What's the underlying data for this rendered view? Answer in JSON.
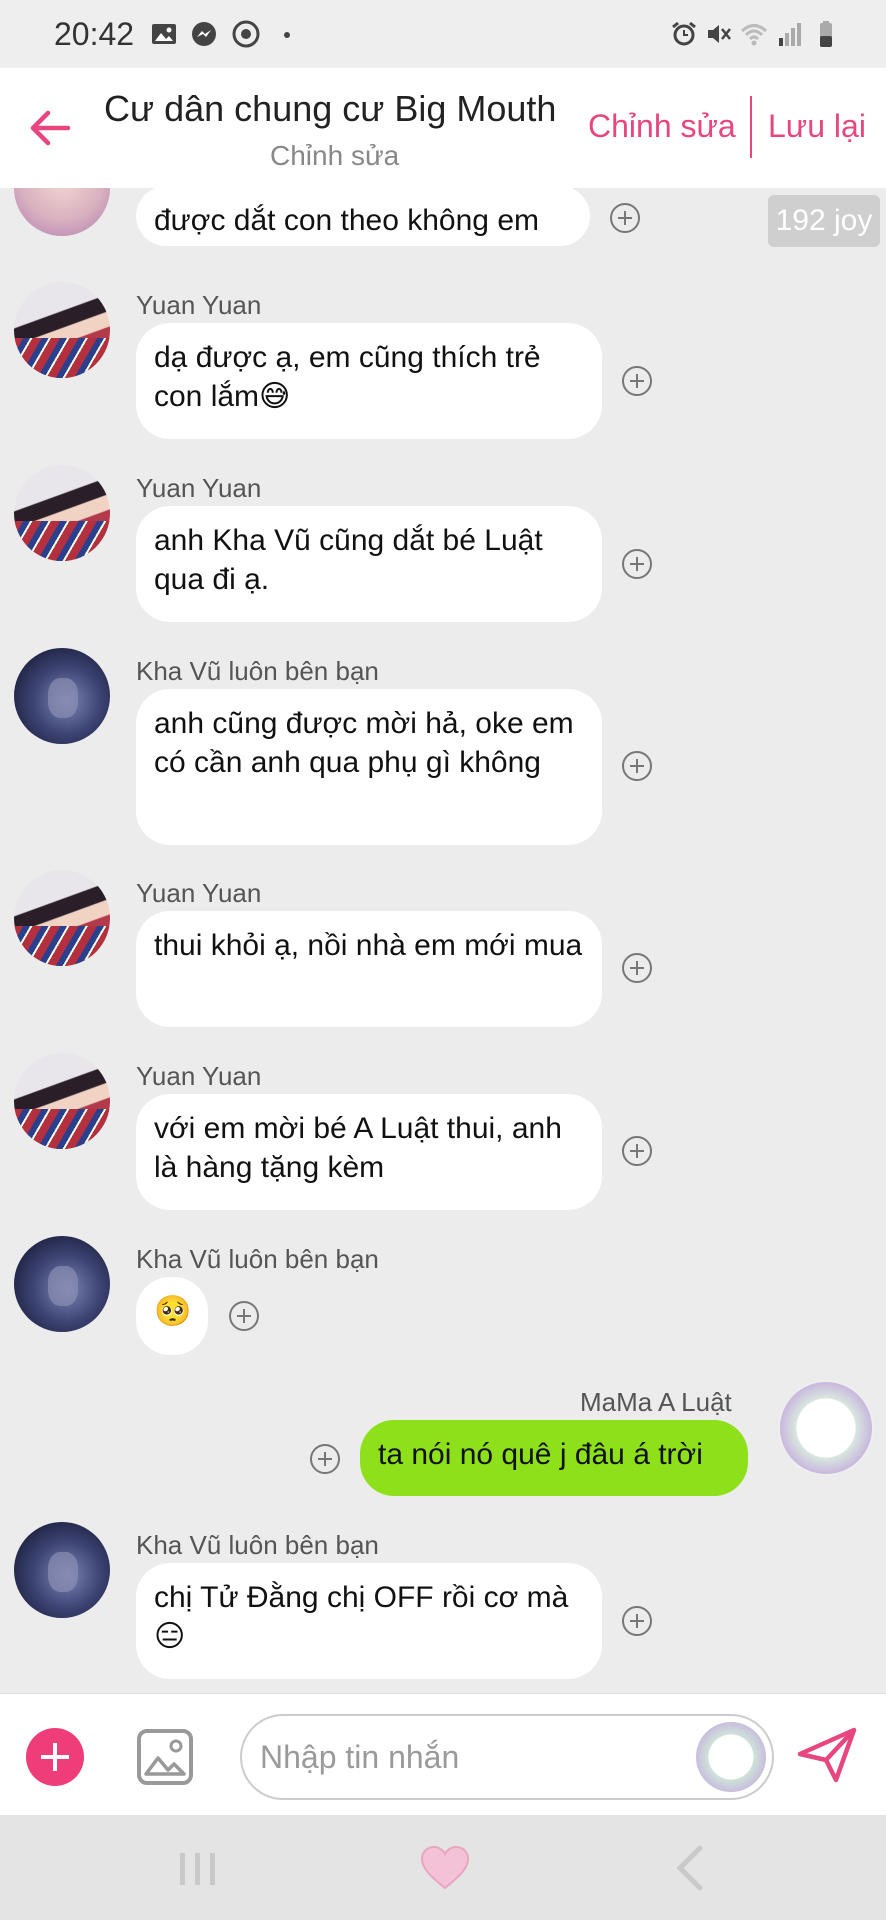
{
  "status_bar": {
    "time": "20:42"
  },
  "header": {
    "title": "Cư dân chung cư Big Mouth",
    "subtitle": "Chỉnh sửa",
    "edit_label": "Chỉnh sửa",
    "save_label": "Lưu lại"
  },
  "messages": {
    "joy_badge": "192 joy",
    "m0": {
      "text": "được dắt con theo không em"
    },
    "m1": {
      "sender": "Yuan Yuan",
      "text": "dạ được ạ, em cũng thích trẻ con lắm😅"
    },
    "m2": {
      "sender": "Yuan Yuan",
      "text": "anh Kha Vũ cũng dắt bé Luật qua đi ạ."
    },
    "m3": {
      "sender": "Kha Vũ luôn bên bạn",
      "text": "anh cũng được mời hả, oke em có cần anh qua phụ gì không"
    },
    "m4": {
      "sender": "Yuan Yuan",
      "text": "thui khỏi ạ, nồi nhà em mới mua"
    },
    "m5": {
      "sender": "Yuan Yuan",
      "text": "với em mời bé A Luật thui, anh là hàng tặng kèm"
    },
    "m6": {
      "sender": "Kha Vũ luôn bên bạn",
      "text": "🥺"
    },
    "m7": {
      "sender": "MaMa A Luật",
      "text": "ta nói nó quê j đâu á trời"
    },
    "m8": {
      "sender": "Kha Vũ luôn bên bạn",
      "text": "chị Tử Đằng chị OFF rồi cơ mà😑"
    }
  },
  "input": {
    "placeholder": "Nhập tin nhắn",
    "value": ""
  },
  "colors": {
    "accent": "#e8467e",
    "my_bubble": "#8ee01a",
    "background": "#ececec"
  }
}
